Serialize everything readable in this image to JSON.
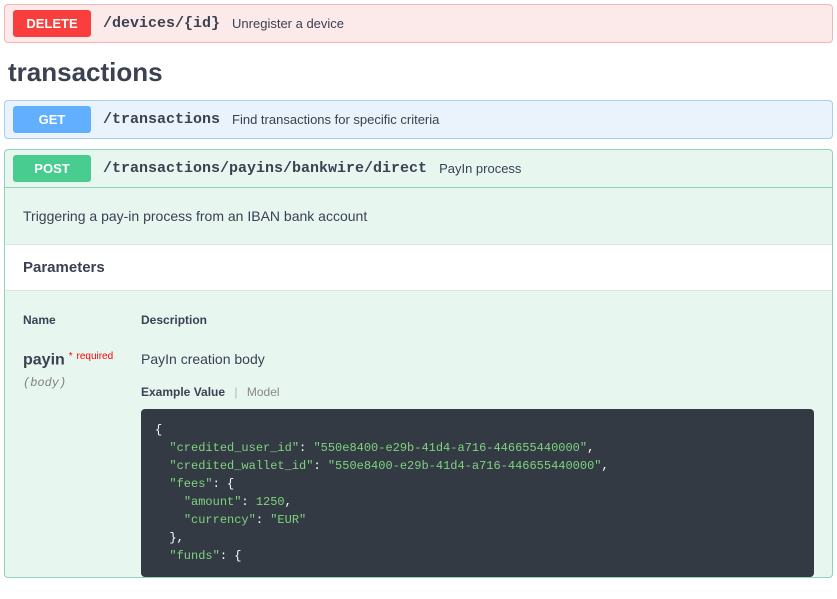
{
  "endpoints": {
    "delete_device": {
      "method": "DELETE",
      "path": "/devices/{id}",
      "summary": "Unregister a device"
    },
    "get_transactions": {
      "method": "GET",
      "path": "/transactions",
      "summary": "Find transactions for specific criteria"
    },
    "post_payin": {
      "method": "POST",
      "path": "/transactions/payins/bankwire/direct",
      "summary": "PayIn process",
      "description": "Triggering a pay-in process from an IBAN bank account"
    }
  },
  "section_title": "transactions",
  "parameters_label": "Parameters",
  "table_headers": {
    "name": "Name",
    "description": "Description"
  },
  "param": {
    "name": "payin",
    "required_label": "required",
    "in": "(body)",
    "description": "PayIn creation body"
  },
  "tabs": {
    "example": "Example Value",
    "model": "Model"
  },
  "example_json": {
    "credited_user_id": "550e8400-e29b-41d4-a716-446655440000",
    "credited_wallet_id": "550e8400-e29b-41d4-a716-446655440000",
    "fees": {
      "amount": 1250,
      "currency": "EUR"
    },
    "funds_key": "funds"
  }
}
